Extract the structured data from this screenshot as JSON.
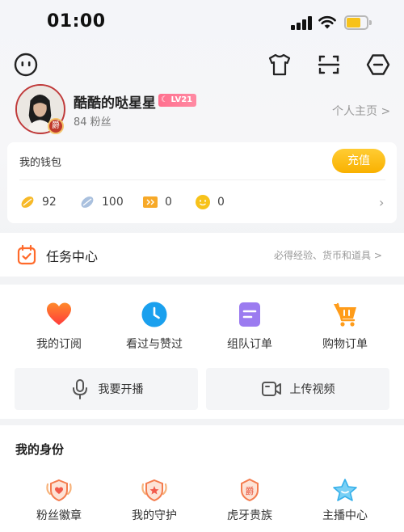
{
  "status_bar": {
    "time": "01:00"
  },
  "profile": {
    "username": "酷酷的哒星星",
    "level": "LV21",
    "fans": "84 粉丝",
    "homepage_link": "个人主页 >"
  },
  "wallet": {
    "title": "我的钱包",
    "recharge_label": "充值",
    "currencies": [
      {
        "icon": "gold-bean-icon",
        "value": "92"
      },
      {
        "icon": "silver-bean-icon",
        "value": "100"
      },
      {
        "icon": "ticket-icon",
        "value": "0"
      },
      {
        "icon": "coin-icon",
        "value": "0"
      }
    ]
  },
  "task_center": {
    "title": "任务中心",
    "subtitle": "必得经验、货币和道具 >"
  },
  "grid": [
    {
      "icon": "heart-icon",
      "label": "我的订阅"
    },
    {
      "icon": "clock-icon",
      "label": "看过与赞过"
    },
    {
      "icon": "document-icon",
      "label": "组队订单"
    },
    {
      "icon": "cart-icon",
      "label": "购物订单"
    }
  ],
  "actions": [
    {
      "icon": "microphone-icon",
      "label": "我要开播"
    },
    {
      "icon": "video-camera-icon",
      "label": "上传视频"
    }
  ],
  "identity": {
    "title": "我的身份",
    "items": [
      {
        "icon": "fan-badge-icon",
        "label": "粉丝徽章"
      },
      {
        "icon": "guard-shield-icon",
        "label": "我的守护"
      },
      {
        "icon": "noble-icon",
        "label": "虎牙贵族"
      },
      {
        "icon": "star-icon",
        "label": "主播中心"
      }
    ]
  },
  "colors": {
    "accent": "#f9b100",
    "level_badge": "#ff6f8e",
    "heart": "#ff5533",
    "clock": "#1aa0ee",
    "document": "#9b7bf0",
    "cart": "#ff9c1a"
  }
}
